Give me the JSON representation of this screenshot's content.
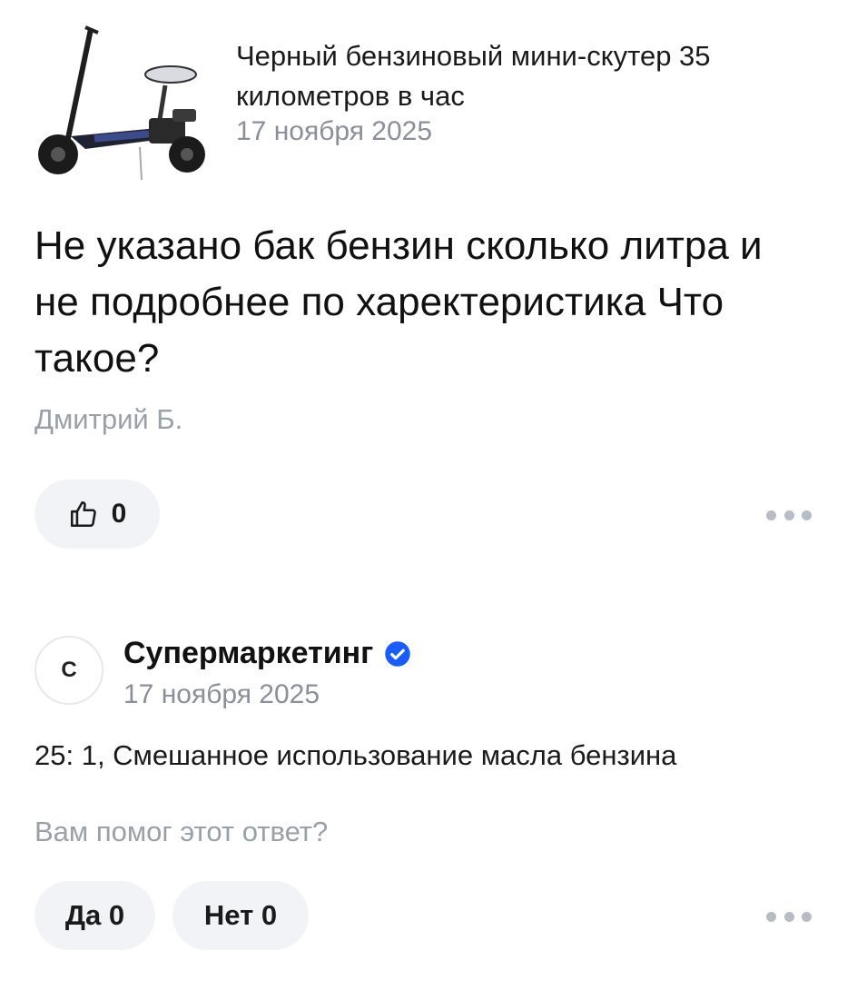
{
  "product": {
    "image_icon": "scooter-image",
    "title": "Черный бензиновый мини-скутер 35 километров в час",
    "date": "17 ноября 2025"
  },
  "question": {
    "text": "Не указано бак бензин сколько литра и не подробнее по харектеристика Что такое?",
    "author": "Дмитрий Б.",
    "likes": "0",
    "like_icon": "thumbs-up-icon",
    "more_icon": "more-dots-icon"
  },
  "answer": {
    "avatar_letter": "С",
    "shop_name": "Супермаркетинг",
    "verified_icon": "verified-badge-icon",
    "date": "17 ноября 2025",
    "text": "25: 1, Смешанное использование масла бензина",
    "helpful_question": "Вам помог этот ответ?",
    "yes_label": "Да 0",
    "no_label": "Нет 0",
    "more_icon": "more-dots-icon"
  },
  "colors": {
    "muted_text": "#8a8f98",
    "pill_bg": "#f1f3f7",
    "verified_blue": "#1a5cff"
  }
}
